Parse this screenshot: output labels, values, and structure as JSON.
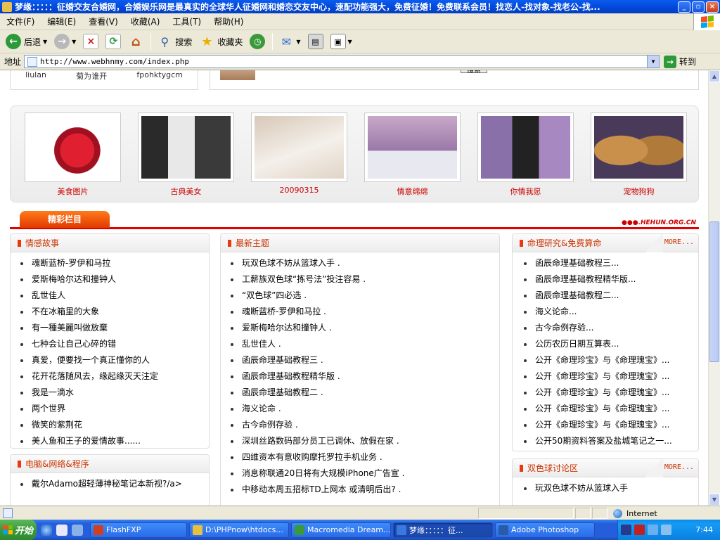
{
  "window": {
    "title": "梦缘：：：：：征婚交友合婚网，合婚娱乐网是最真实的全球华人征婚网和婚恋交友中心，速配功能强大，免费征婚！免费联系会员！找恋人-找对象-找老公-找..."
  },
  "menu": [
    "文件(F)",
    "编辑(E)",
    "查看(V)",
    "收藏(A)",
    "工具(T)",
    "帮助(H)"
  ],
  "toolbar": {
    "back": "后退",
    "search": "搜索",
    "favorites": "收藏夹"
  },
  "address": {
    "label": "地址",
    "url": "http://www.webhnmy.com/index.php",
    "go": "转到"
  },
  "top_partial": {
    "usernames": [
      "liulan",
      "菊为谁开",
      "fpohktygcm"
    ],
    "search_button": "搜索"
  },
  "gallery": [
    {
      "caption": "美食图片",
      "color": "#c8202a"
    },
    {
      "caption": "古典美女",
      "color": "#3a3a3a"
    },
    {
      "caption": "20090315",
      "color": "#c8b8a8"
    },
    {
      "caption": "情意绵绵",
      "color": "#b890b0"
    },
    {
      "caption": "你情我愿",
      "color": "#8a70a8"
    },
    {
      "caption": "宠物狗狗",
      "color": "#b07a3a"
    }
  ],
  "section": {
    "title": "精彩栏目",
    "logo_text": "●●●.HEHUN.ORG.CN"
  },
  "panels": {
    "emotion": {
      "title": "情感故事",
      "items": [
        "魂断蓝桥-罗伊和马拉",
        "爱斯梅哈尔达和撞钟人",
        "乱世佳人",
        "不在冰箱里的大象",
        "有一種美麗叫做放棄",
        "七种会让自己心碎的错",
        "真爱，便要找一个真正懂你的人",
        "花开花落随风去，缘起缘灭天注定",
        "我是一滴水",
        "两个世界",
        "微笑的紫荆花",
        "美人鱼和王子的爱情故事......"
      ]
    },
    "computer": {
      "title": "电脑&网络&程序",
      "items": [
        "戴尔Adamo超轻薄神秘笔记本新视?/a>"
      ]
    },
    "latest": {
      "title": "最新主题",
      "items": [
        "玩双色球不妨从篮球入手 .",
        "工薪族双色球“拣号法”投注容易 .",
        "“双色球”四必选 .",
        "魂断蓝桥-罗伊和马拉 .",
        "爱斯梅哈尔达和撞钟人 .",
        "乱世佳人 .",
        "函辰命理基础教程三 .",
        "函辰命理基础教程精华版 .",
        "函辰命理基础教程二 .",
        "海义论命 .",
        "古今命例存验 .",
        "深圳丝路数码部分员工已调休、放假在家 .",
        "四维资本有意收购摩托罗拉手机业务 .",
        "消息称联通20日将有大规模iPhone广告宣 .",
        "中移动本周五招标TD上网本 或清明后出? ."
      ]
    },
    "fortune": {
      "title": "命理研究&免费算命",
      "more": "MORE...",
      "items": [
        "函辰命理基础教程三...",
        "函辰命理基础教程精华版...",
        "函辰命理基础教程二...",
        "海义论命...",
        "古今命例存验...",
        "公历农历日期互算表...",
        "公开《命理珍宝》与《命理瑰宝》...",
        "公开《命理珍宝》与《命理瑰宝》...",
        "公开《命理珍宝》与《命理瑰宝》...",
        "公开《命理珍宝》与《命理瑰宝》...",
        "公开《命理珍宝》与《命理瑰宝》...",
        "公开50期资料答案及盐城笔记之一..."
      ]
    },
    "lottery": {
      "title": "双色球讨论区",
      "more": "MORE...",
      "items": [
        "玩双色球不妨从篮球入手"
      ]
    }
  },
  "status": {
    "zone": "Internet"
  },
  "taskbar": {
    "start": "开始",
    "tasks": [
      {
        "label": "FlashFXP",
        "color": "#d04020"
      },
      {
        "label": "D:\\PHPnow\\htdocs...",
        "color": "#e8c040"
      },
      {
        "label": "Macromedia Dream...",
        "color": "#3a9a3a"
      },
      {
        "label": "梦缘：：：：：征...",
        "color": "#3a7ae0"
      },
      {
        "label": "Adobe Photoshop",
        "color": "#2a5aa8"
      }
    ],
    "clock": "7:44"
  }
}
